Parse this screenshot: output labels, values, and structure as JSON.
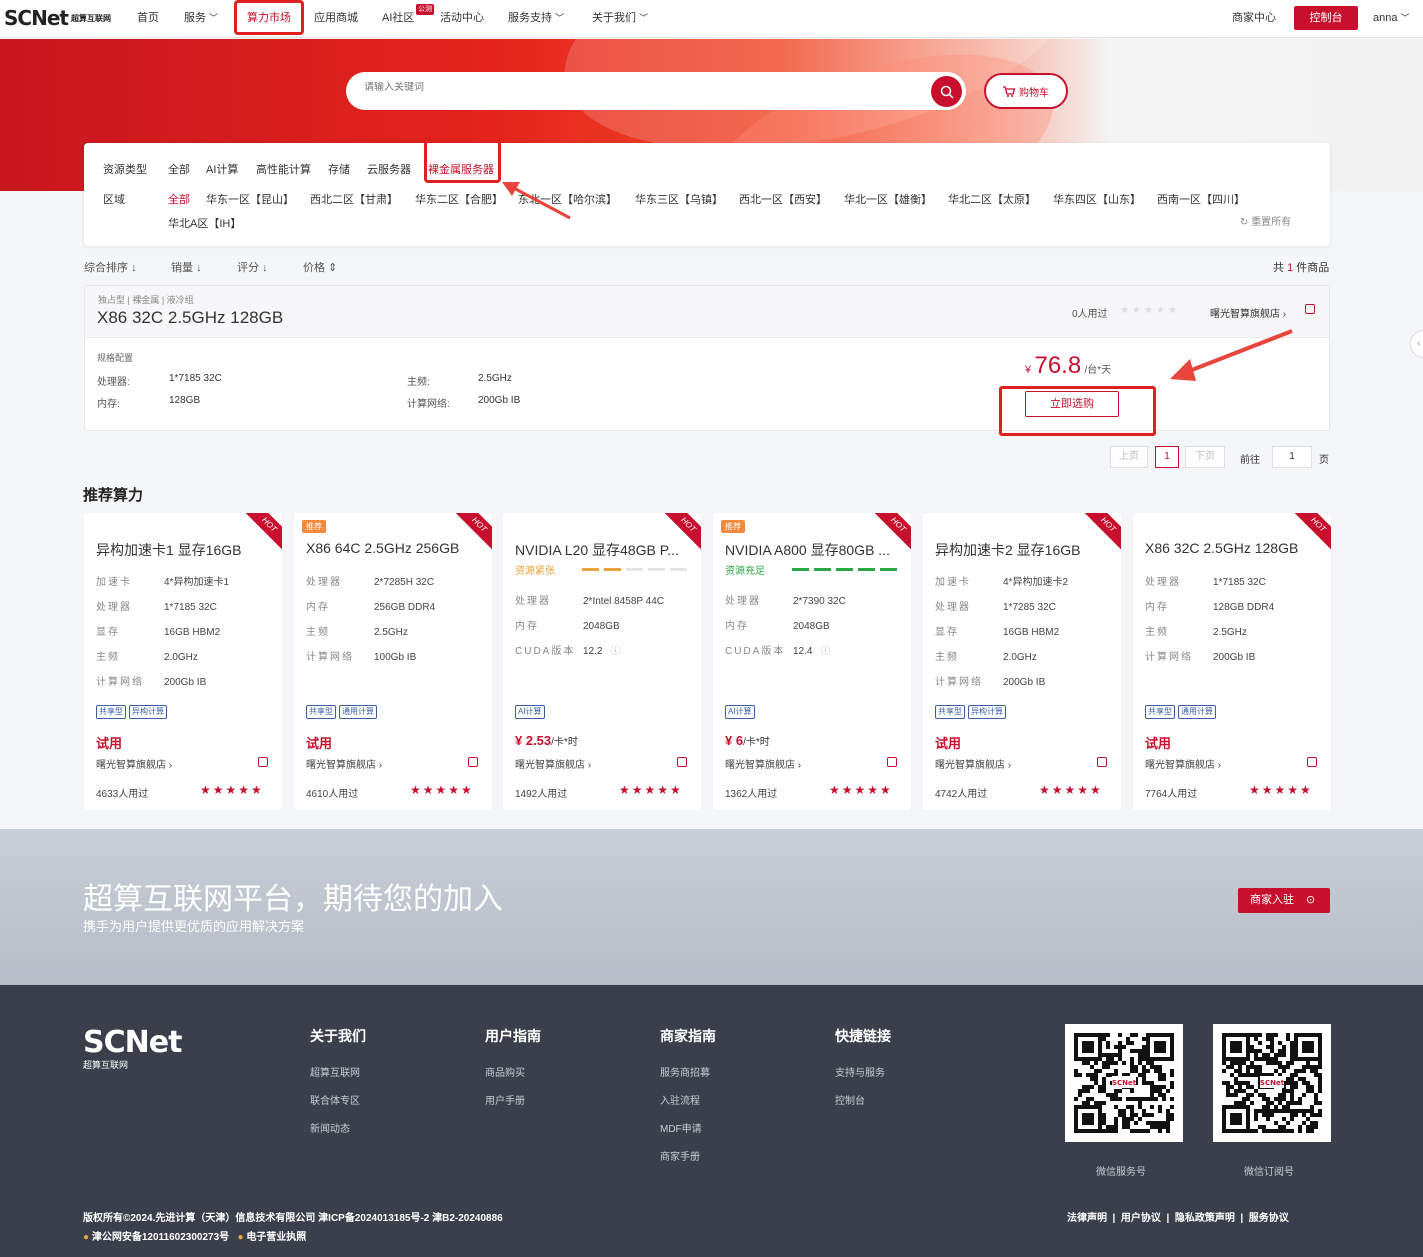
{
  "header": {
    "logo": "SCNet",
    "logo_sub": "超算互联网",
    "nav": [
      "首页",
      "服务",
      "算力市场",
      "应用商城",
      "AI社区",
      "活动中心",
      "服务支持",
      "关于我们"
    ],
    "ai_badge": "公测",
    "merchant": "商家中心",
    "console": "控制台",
    "user": "anna"
  },
  "search": {
    "placeholder": "请输入关键词",
    "cart": "购物车"
  },
  "filter": {
    "type_label": "资源类型",
    "types": [
      "全部",
      "AI计算",
      "高性能计算",
      "存储",
      "云服务器",
      "裸金属服务器"
    ],
    "region_label": "区域",
    "regions": [
      "全部",
      "华东一区【昆山】",
      "西北二区【甘肃】",
      "华东二区【合肥】",
      "东北一区【哈尔滨】",
      "华东三区【乌镇】",
      "西北一区【西安】",
      "华北一区【雄衡】",
      "华北二区【太原】",
      "华东四区【山东】",
      "西南一区【四川】",
      "华北A区【IH】"
    ],
    "reset": "重置所有"
  },
  "sort": {
    "items": [
      "综合排序",
      "销量",
      "评分",
      "价格"
    ],
    "total_prefix": "共",
    "total_count": "1",
    "total_suffix": "件商品"
  },
  "product": {
    "tags": "独占型 | 裸金属 | 液冷组",
    "title": "X86 32C 2.5GHz 128GB",
    "used": "0人用过",
    "store": "曙光智算旗舰店",
    "spec_title": "规格配置",
    "specs": [
      {
        "k": "处理器:",
        "v": "1*7185 32C"
      },
      {
        "k": "主频:",
        "v": "2.5GHz"
      },
      {
        "k": "内存:",
        "v": "128GB"
      },
      {
        "k": "计算网络:",
        "v": "200Gb IB"
      }
    ],
    "currency": "¥",
    "price": "76.8",
    "unit": "/台*天",
    "buy": "立即选购"
  },
  "pagination": {
    "prev": "上页",
    "page": "1",
    "next": "下页",
    "goto": "前往",
    "goto_val": "1",
    "page_suffix": "页"
  },
  "rec": {
    "title": "推荐算力",
    "cards": [
      {
        "title": "异构加速卡1 显存16GB",
        "badge": "",
        "status": "",
        "specs": [
          [
            "加速卡",
            "4*异构加速卡1"
          ],
          [
            "处理器",
            "1*7185 32C"
          ],
          [
            "显存",
            "16GB HBM2"
          ],
          [
            "主频",
            "2.0GHz"
          ],
          [
            "计算网络",
            "200Gb IB"
          ]
        ],
        "tags": [
          "共享型",
          "异构计算"
        ],
        "price": "试用",
        "price_unit": "",
        "store": "曙光智算旗舰店",
        "used": "4633人用过"
      },
      {
        "title": "X86 64C 2.5GHz 256GB",
        "badge": "推荐",
        "status": "",
        "specs": [
          [
            "处理器",
            "2*7285H 32C"
          ],
          [
            "内存",
            "256GB DDR4"
          ],
          [
            "主频",
            "2.5GHz"
          ],
          [
            "计算网络",
            "100Gb IB"
          ]
        ],
        "tags": [
          "共享型",
          "通用计算"
        ],
        "price": "试用",
        "price_unit": "",
        "store": "曙光智算旗舰店",
        "used": "4610人用过"
      },
      {
        "title": "NVIDIA L20 显存48GB P...",
        "badge": "",
        "status": "资源紧张",
        "specs": [
          [
            "处理器",
            "2*Intel 8458P 44C"
          ],
          [
            "内存",
            "2048GB"
          ],
          [
            "CUDA版本",
            "12.2"
          ]
        ],
        "tags": [
          "AI计算"
        ],
        "price": "¥ 2.53",
        "price_unit": "/卡*时",
        "store": "曙光智算旗舰店",
        "used": "1492人用过"
      },
      {
        "title": "NVIDIA A800 显存80GB ...",
        "badge": "推荐",
        "status": "资源充足",
        "specs": [
          [
            "处理器",
            "2*7390 32C"
          ],
          [
            "内存",
            "2048GB"
          ],
          [
            "CUDA版本",
            "12.4"
          ]
        ],
        "tags": [
          "AI计算"
        ],
        "price": "¥ 6",
        "price_unit": "/卡*时",
        "store": "曙光智算旗舰店",
        "used": "1362人用过"
      },
      {
        "title": "异构加速卡2 显存16GB",
        "badge": "",
        "status": "",
        "specs": [
          [
            "加速卡",
            "4*异构加速卡2"
          ],
          [
            "处理器",
            "1*7285 32C"
          ],
          [
            "显存",
            "16GB HBM2"
          ],
          [
            "主频",
            "2.0GHz"
          ],
          [
            "计算网络",
            "200Gb IB"
          ]
        ],
        "tags": [
          "共享型",
          "异构计算"
        ],
        "price": "试用",
        "price_unit": "",
        "store": "曙光智算旗舰店",
        "used": "4742人用过"
      },
      {
        "title": "X86 32C 2.5GHz 128GB",
        "badge": "",
        "status": "",
        "specs": [
          [
            "处理器",
            "1*7185 32C"
          ],
          [
            "内存",
            "128GB DDR4"
          ],
          [
            "主频",
            "2.5GHz"
          ],
          [
            "计算网络",
            "200Gb IB"
          ]
        ],
        "tags": [
          "共享型",
          "通用计算"
        ],
        "price": "试用",
        "price_unit": "",
        "store": "曙光智算旗舰店",
        "used": "7764人用过"
      }
    ],
    "hot": "HOT"
  },
  "join": {
    "title": "超算互联网平台，期待您的加入",
    "subtitle": "携手为用户提供更优质的应用解决方案",
    "button": "商家入驻"
  },
  "footer": {
    "cols": [
      {
        "h": "关于我们",
        "items": [
          "超算互联网",
          "联合体专区",
          "新闻动态"
        ]
      },
      {
        "h": "用户指南",
        "items": [
          "商品购买",
          "用户手册"
        ]
      },
      {
        "h": "商家指南",
        "items": [
          "服务商招募",
          "入驻流程",
          "MDF申请",
          "商家手册"
        ]
      },
      {
        "h": "快捷链接",
        "items": [
          "支持与服务",
          "控制台"
        ]
      }
    ],
    "qr1": "微信服务号",
    "qr2": "微信订阅号",
    "copyright": "版权所有©2024.先进计算（天津）信息技术有限公司 津ICP备2024013185号-2  津B2-20240886",
    "police": "津公网安备12011602300273号",
    "license": "电子营业执照",
    "links": [
      "法律声明",
      "用户协议",
      "隐私政策声明",
      "服务协议"
    ]
  }
}
